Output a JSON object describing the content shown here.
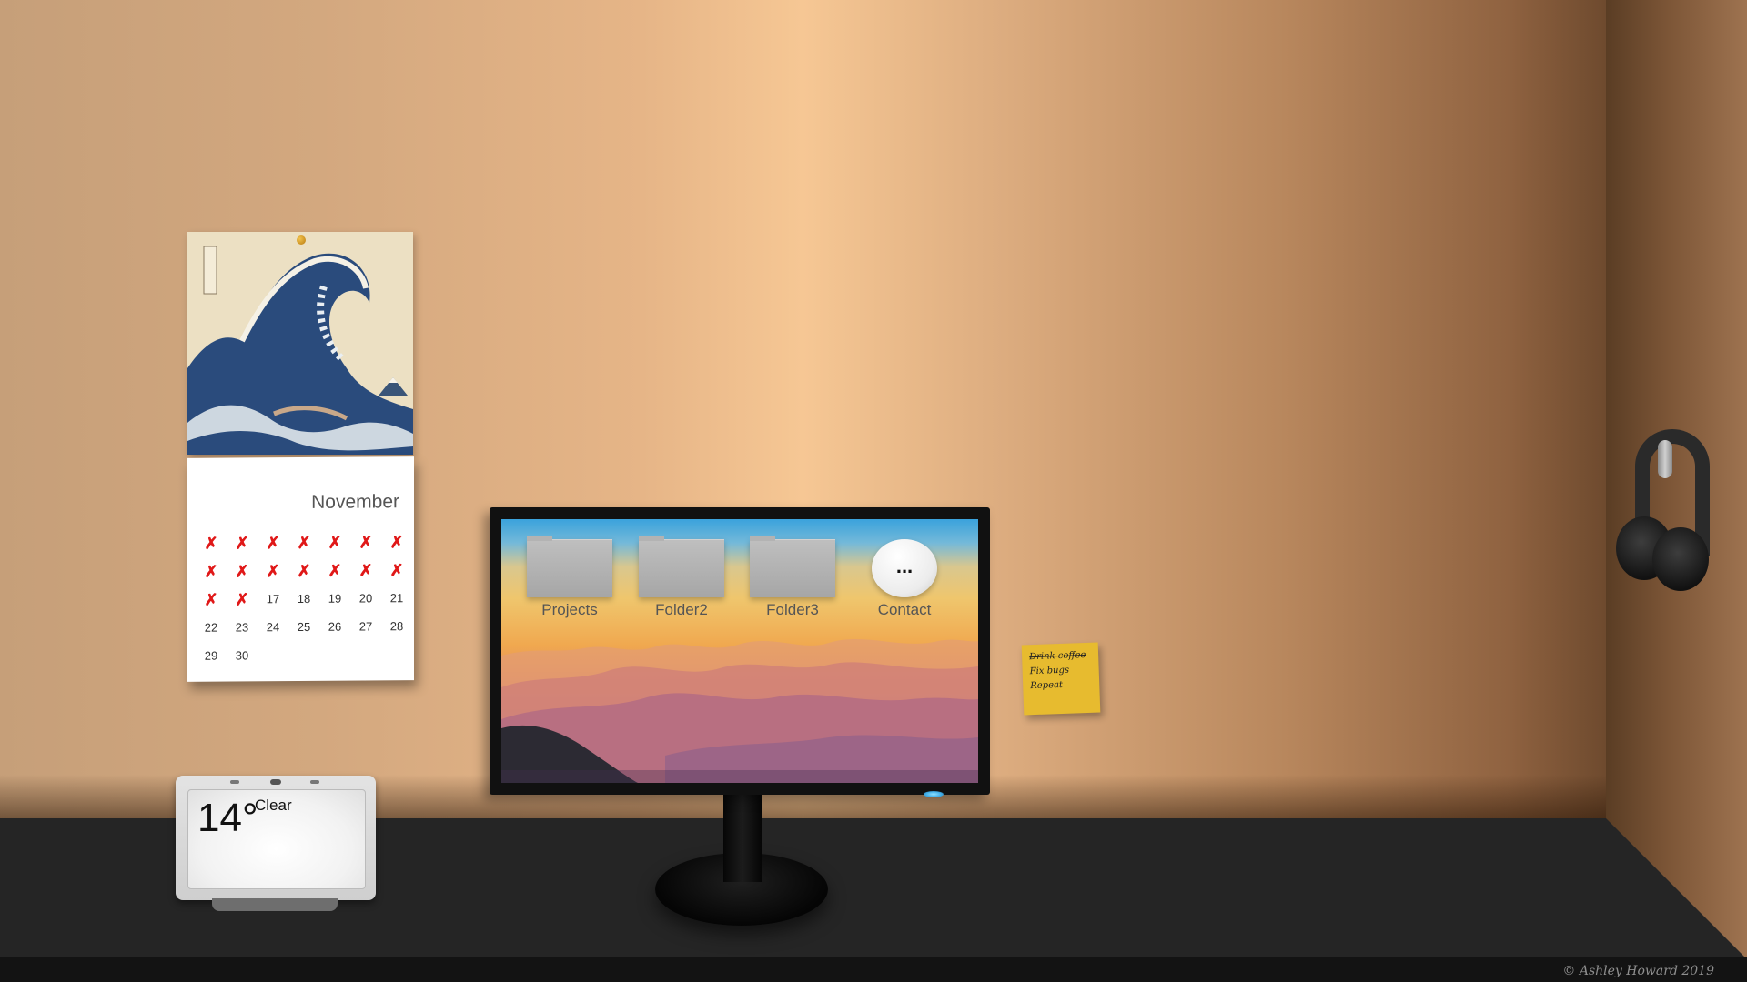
{
  "calendar": {
    "month": "November",
    "days": [
      {
        "label": "✗",
        "crossed": true
      },
      {
        "label": "✗",
        "crossed": true
      },
      {
        "label": "✗",
        "crossed": true
      },
      {
        "label": "✗",
        "crossed": true
      },
      {
        "label": "✗",
        "crossed": true
      },
      {
        "label": "✗",
        "crossed": true
      },
      {
        "label": "✗",
        "crossed": true
      },
      {
        "label": "✗",
        "crossed": true
      },
      {
        "label": "✗",
        "crossed": true
      },
      {
        "label": "✗",
        "crossed": true
      },
      {
        "label": "✗",
        "crossed": true
      },
      {
        "label": "✗",
        "crossed": true
      },
      {
        "label": "✗",
        "crossed": true
      },
      {
        "label": "✗",
        "crossed": true
      },
      {
        "label": "✗",
        "crossed": true
      },
      {
        "label": "✗",
        "crossed": true
      },
      {
        "label": "17",
        "crossed": false
      },
      {
        "label": "18",
        "crossed": false
      },
      {
        "label": "19",
        "crossed": false
      },
      {
        "label": "20",
        "crossed": false
      },
      {
        "label": "21",
        "crossed": false
      },
      {
        "label": "22",
        "crossed": false
      },
      {
        "label": "23",
        "crossed": false
      },
      {
        "label": "24",
        "crossed": false
      },
      {
        "label": "25",
        "crossed": false
      },
      {
        "label": "26",
        "crossed": false
      },
      {
        "label": "27",
        "crossed": false
      },
      {
        "label": "28",
        "crossed": false
      },
      {
        "label": "29",
        "crossed": false
      },
      {
        "label": "30",
        "crossed": false
      }
    ],
    "cross_color": "#e01818"
  },
  "monitor": {
    "desktop_icons": [
      {
        "label": "Projects",
        "icon": "folder-icon"
      },
      {
        "label": "Folder2",
        "icon": "folder-icon"
      },
      {
        "label": "Folder3",
        "icon": "folder-icon"
      },
      {
        "label": "Contact",
        "icon": "chat-bubble-icon",
        "glyph": "..."
      }
    ],
    "power_led_color": "#3ba8e4"
  },
  "sticky_note": {
    "lines": [
      {
        "text": "Drink coffee",
        "done": true
      },
      {
        "text": "Fix bugs",
        "done": false
      },
      {
        "text": "Repeat",
        "done": false
      }
    ],
    "color": "#e7bb2f"
  },
  "smart_display": {
    "temperature": "14°",
    "condition": "Clear"
  },
  "footer": {
    "copyright": "© Ashley Howard 2019"
  }
}
